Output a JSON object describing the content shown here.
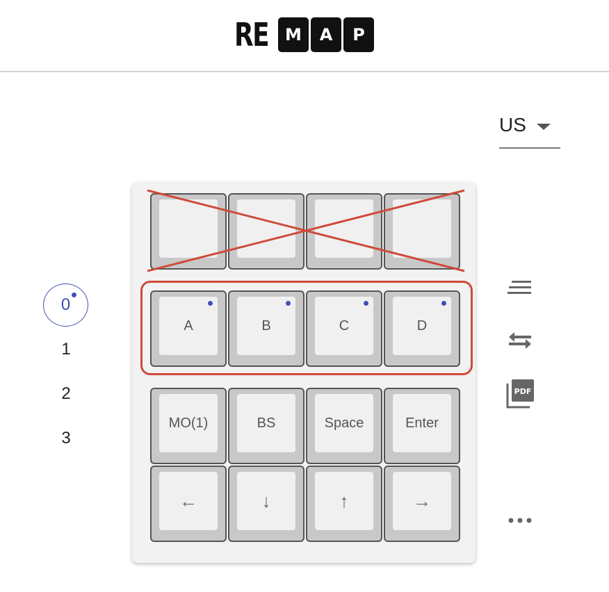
{
  "logo": {
    "text_re": "RE",
    "boxes": [
      "M",
      "A",
      "P"
    ]
  },
  "keyboard_layout": {
    "selected": "US"
  },
  "layers": [
    {
      "label": "0",
      "selected": true
    },
    {
      "label": "1",
      "selected": false
    },
    {
      "label": "2",
      "selected": false
    },
    {
      "label": "3",
      "selected": false
    }
  ],
  "keys": {
    "row_disabled": [
      "",
      "",
      "",
      ""
    ],
    "row_selected": [
      "A",
      "B",
      "C",
      "D"
    ],
    "row3": [
      "MO(1)",
      "BS",
      "Space",
      "Enter"
    ],
    "row4": [
      "←",
      "↓",
      "↑",
      "→"
    ]
  },
  "colors": {
    "accent": "#3f51b5",
    "highlight": "#d04a3a",
    "keycap": "#f0f0f0",
    "key_base": "#c8c8c8"
  },
  "tools": [
    "lines-icon",
    "swap-icon",
    "pdf-icon",
    "more-icon"
  ]
}
